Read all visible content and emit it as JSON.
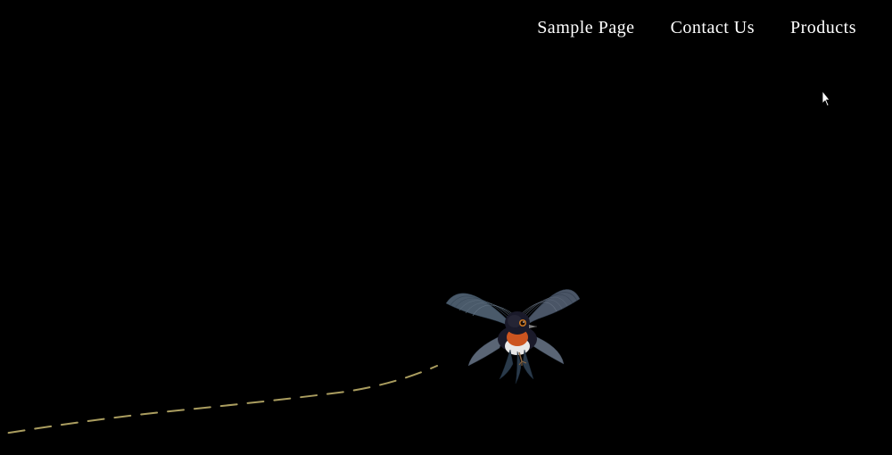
{
  "nav": {
    "links": [
      {
        "label": "Sample Page",
        "id": "sample-page"
      },
      {
        "label": "Contact Us",
        "id": "contact-us"
      },
      {
        "label": "Products",
        "id": "products"
      }
    ]
  },
  "colors": {
    "background": "#000000",
    "text": "#ffffff",
    "dash": "#d4c89a"
  }
}
